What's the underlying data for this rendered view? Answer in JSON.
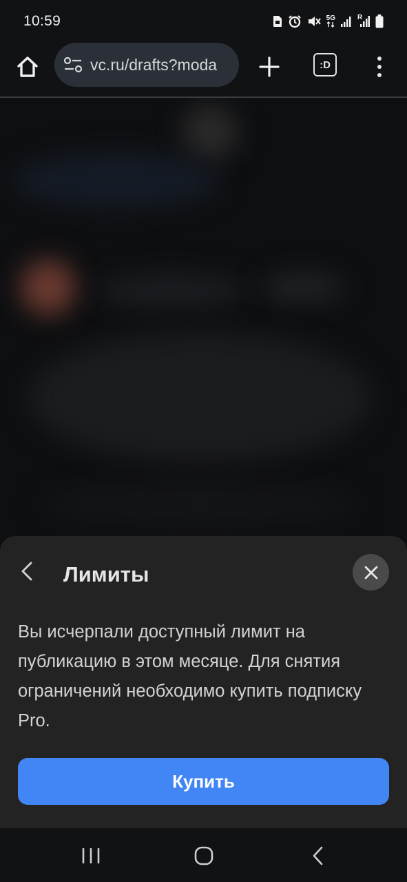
{
  "status_bar": {
    "time": "10:59",
    "icons": [
      "sim-icon",
      "alarm-icon",
      "mute-icon",
      "5g-icon",
      "signal-icon",
      "signal-r-icon",
      "battery-icon"
    ],
    "network_label": "5G",
    "roaming_label": "R"
  },
  "browser": {
    "url": "vc.ru/drafts?moda",
    "tab_switcher_label": ":D"
  },
  "sheet": {
    "title": "Лимиты",
    "message": "Вы исчерпали доступный лимит на публикацию в этом месяце. Для снятия ограничений необходимо купить подписку Pro.",
    "buy_label": "Купить"
  },
  "colors": {
    "accent": "#4285f4",
    "sheet_bg": "#232323",
    "bar_bg": "#111214"
  }
}
